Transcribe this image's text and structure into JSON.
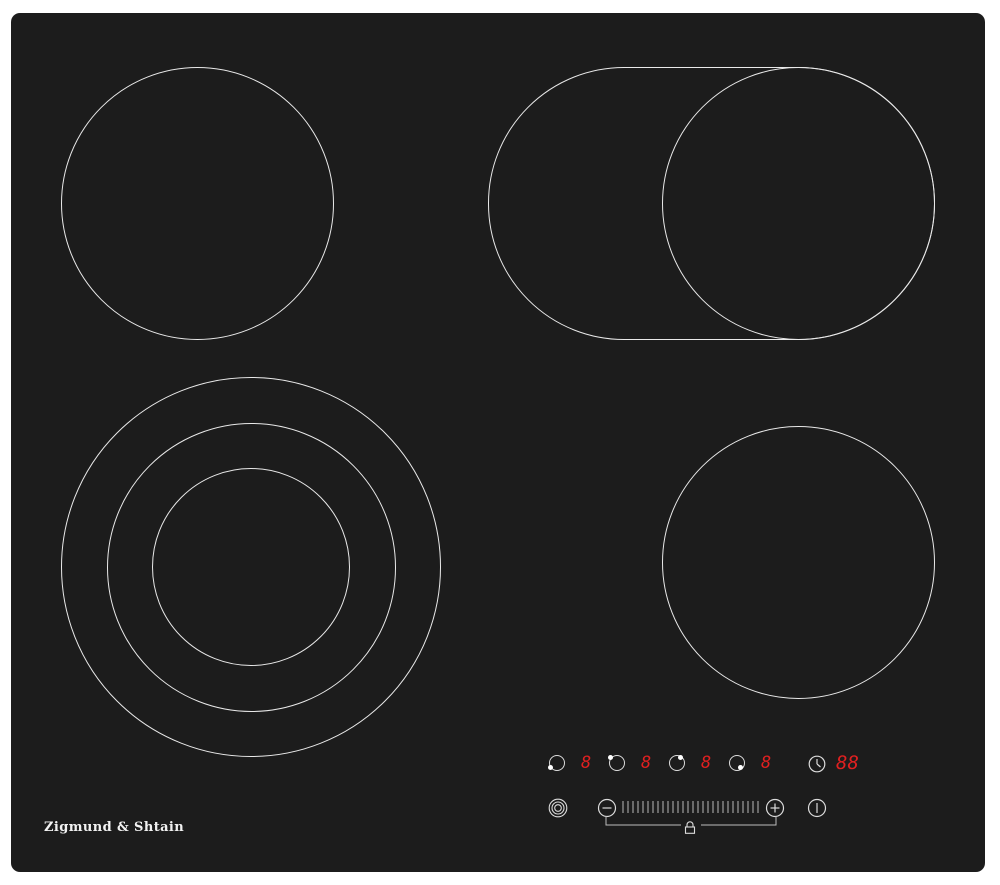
{
  "brand": {
    "name": "Zigmund & Shtain"
  },
  "colors": {
    "glass": "#1c1c1c",
    "ring": "#e9e9e9",
    "display": "#e02020"
  },
  "cooking_zones": [
    {
      "id": "rear-left",
      "type": "single",
      "icon": "single-ring-zone"
    },
    {
      "id": "rear-right",
      "type": "oval-extended",
      "icon": "oval-extended-zone"
    },
    {
      "id": "front-left",
      "type": "triple-ring",
      "icon": "triple-ring-zone"
    },
    {
      "id": "front-right",
      "type": "single",
      "icon": "single-ring-zone"
    }
  ],
  "controls": {
    "zone_displays": [
      "8",
      "8",
      "8",
      "8"
    ],
    "timer_display": "88",
    "icons": {
      "zone_select": "zone-select-icon",
      "timer": "clock-icon",
      "dual_zone": "dual-zone-icon",
      "minus": "minus-icon",
      "plus": "plus-icon",
      "lock": "lock-icon",
      "power": "power-icon"
    }
  }
}
